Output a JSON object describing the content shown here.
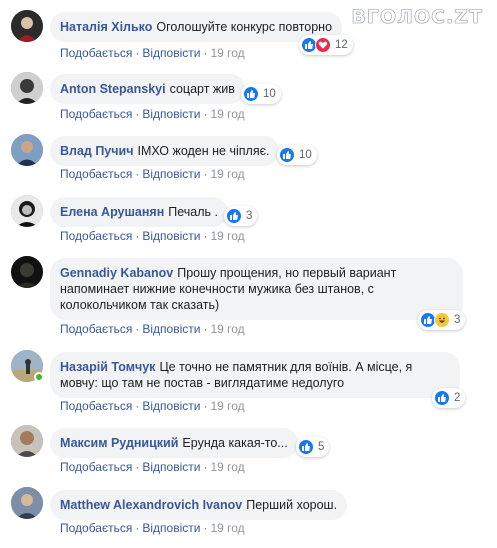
{
  "watermark": {
    "text": "ВГОЛОС.ZT"
  },
  "actions": {
    "like": "Подобається",
    "reply": "Відповісти",
    "separator": "·"
  },
  "comments": [
    {
      "author": "Наталія Хілько",
      "text": "Оголошуйте конкурс повторно",
      "time": "19 год",
      "reactions": [
        "like",
        "love"
      ],
      "count": "12"
    },
    {
      "author": "Anton Stepanskyi",
      "text": "соцарт жив",
      "time": "19 год",
      "reactions": [
        "like"
      ],
      "count": "10"
    },
    {
      "author": "Влад Пучич",
      "text": "ІМХО жоден не чіпляє.",
      "time": "19 год",
      "reactions": [
        "like"
      ],
      "count": "10"
    },
    {
      "author": "Елена Арушанян",
      "text": "Печаль .",
      "time": "19 год",
      "reactions": [
        "like"
      ],
      "count": "3"
    },
    {
      "author": "Gennadiy Kabanov",
      "text": "Прошу прощения, но первый вариант",
      "text2": "напоминает нижние конечности мужика без штанов, с",
      "text3": "колокольчиком так сказать)",
      "time": "19 год",
      "reactions": [
        "like",
        "haha"
      ],
      "count": "3"
    },
    {
      "author": "Назарій Томчук",
      "text": "Це точно не памятник для воїнів. А місце, я",
      "text2": "мовчу: що там не постав - виглядатиме недолуго",
      "time": "19 год",
      "reactions": [
        "like"
      ],
      "count": "2"
    },
    {
      "author": "Максим Рудницкий",
      "text": "Ерунда какая-то...",
      "time": "19 год",
      "reactions": [
        "like"
      ],
      "count": "5"
    },
    {
      "author": "Matthew Alexandrovich Ivanov",
      "text": "Перший хорош.",
      "time": "19 год",
      "reactions": [],
      "count": ""
    }
  ],
  "colors": {
    "link": "#385898",
    "bubble": "#f2f3f5",
    "like": "#1877f2",
    "love": "#f0284a",
    "haha": "#f7c53c",
    "online": "#42b72a"
  }
}
